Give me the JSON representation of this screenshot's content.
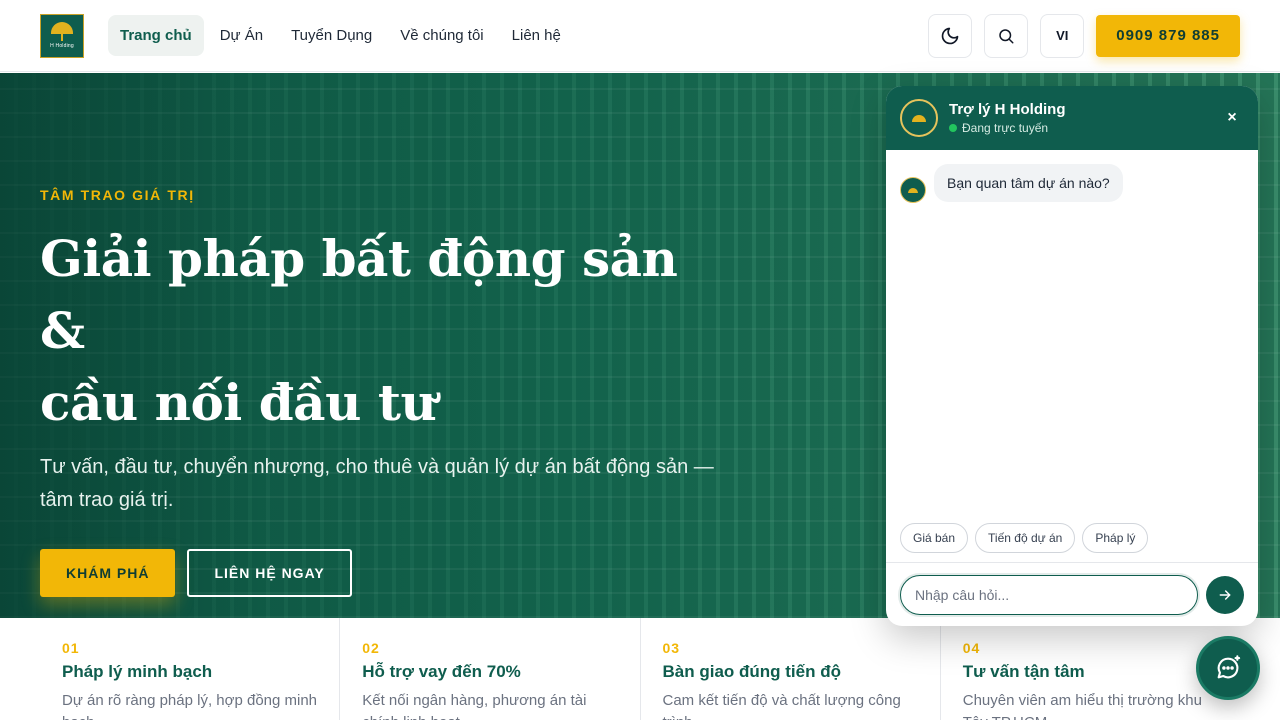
{
  "header": {
    "logo_text": "H Holding",
    "nav": [
      {
        "label": "Trang chủ",
        "active": true
      },
      {
        "label": "Dự Án",
        "active": false
      },
      {
        "label": "Tuyển Dụng",
        "active": false
      },
      {
        "label": "Về chúng tôi",
        "active": false
      },
      {
        "label": "Liên hệ",
        "active": false
      }
    ],
    "theme_icon": "moon-icon",
    "search_icon": "search-icon",
    "lang": "VI",
    "phone": "0909 879 885"
  },
  "hero": {
    "eyebrow": "TÂM TRAO GIÁ TRỊ",
    "title_line1": "Giải pháp bất động sản &",
    "title_line2": "cầu nối đầu tư",
    "subtitle": "Tư vấn, đầu tư, chuyển nhượng, cho thuê và quản lý dự án bất động sản — tâm trao giá trị.",
    "primary_cta": "KHÁM PHÁ",
    "secondary_cta": "LIÊN HỆ NGAY"
  },
  "features": [
    {
      "num": "01",
      "title": "Pháp lý minh bạch",
      "desc": "Dự án rõ ràng pháp lý, hợp đồng minh bạch."
    },
    {
      "num": "02",
      "title": "Hỗ trợ vay đến 70%",
      "desc": "Kết nối ngân hàng, phương án tài chính linh hoạt."
    },
    {
      "num": "03",
      "title": "Bàn giao đúng tiến độ",
      "desc": "Cam kết tiến độ và chất lượng công trình."
    },
    {
      "num": "04",
      "title": "Tư vấn tận tâm",
      "desc": "Chuyên viên am hiểu thị trường khu Tây TP.HCM."
    }
  ],
  "chat": {
    "title": "Trợ lý H Holding",
    "status": "Đang trực tuyến",
    "close": "×",
    "messages": [
      {
        "from": "bot",
        "text": "Bạn quan tâm dự án nào?"
      }
    ],
    "chips": [
      "Giá bán",
      "Tiến độ dự án",
      "Pháp lý"
    ],
    "input_placeholder": "Nhập câu hỏi...",
    "send_icon": "arrow-right-icon"
  },
  "fab_icon": "chat-bubble-icon",
  "colors": {
    "brand_green": "#0f5d4e",
    "accent_yellow": "#f2b707"
  }
}
